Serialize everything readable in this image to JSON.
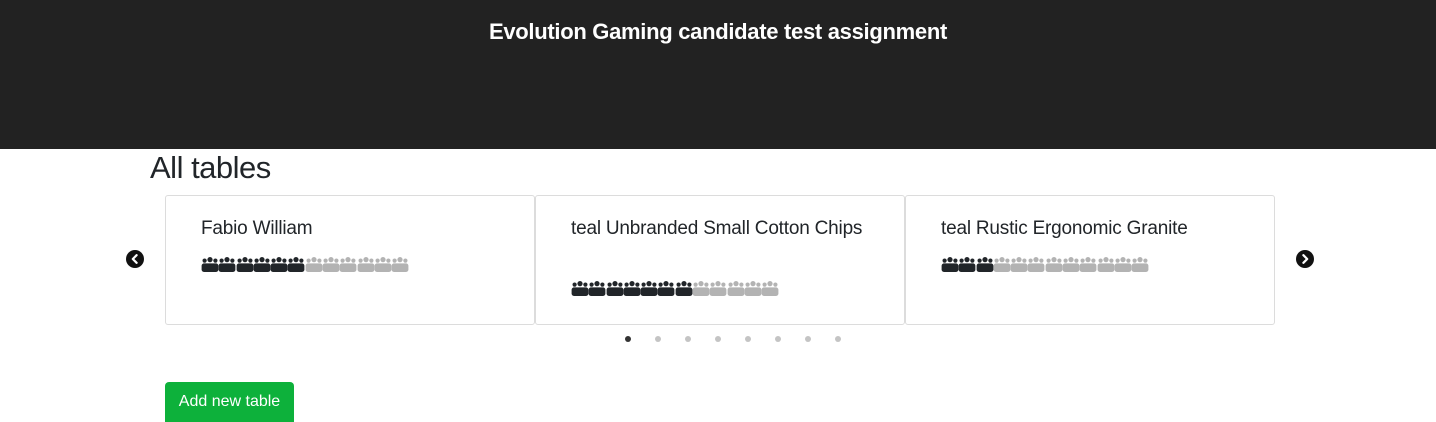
{
  "header": {
    "title": "Evolution Gaming candidate test assignment",
    "background": "#222222"
  },
  "main": {
    "section_title": "All tables",
    "carousel": {
      "prev_icon": "chevron-left-circle-icon",
      "next_icon": "chevron-right-circle-icon",
      "tables": [
        {
          "name": "Fabio William",
          "seats_occupied": 6,
          "seats_total": 12
        },
        {
          "name": "teal Unbranded Small Cotton Chips",
          "seats_occupied": 7,
          "seats_total": 12
        },
        {
          "name": "teal Rustic Ergonomic Granite",
          "seats_occupied": 3,
          "seats_total": 12
        }
      ],
      "seat_icon": "group-icon",
      "page_count": 8,
      "active_page": 1
    },
    "add_button_label": "Add new table"
  },
  "colors": {
    "seat_occupied": "#212529",
    "seat_free": "#b3b3b3",
    "dot_active": "#333333",
    "dot_inactive": "#c4c4c4",
    "button": "#0db13b"
  }
}
